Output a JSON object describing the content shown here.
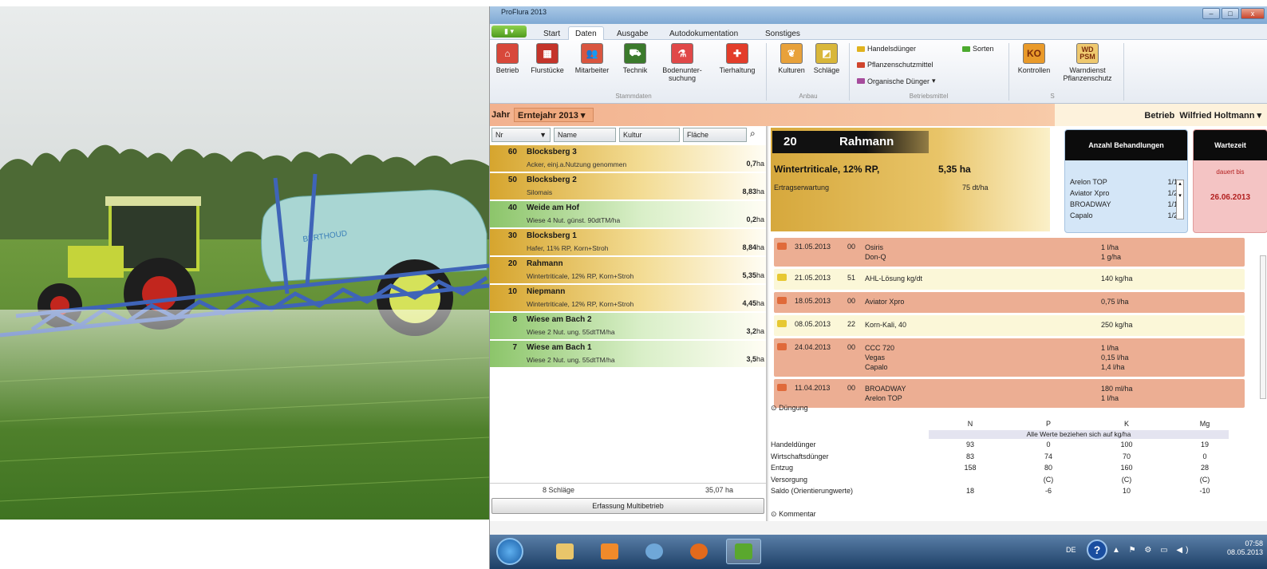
{
  "window": {
    "title": "ProFlura 2013",
    "minimize": "–",
    "maximize": "□",
    "close": "x"
  },
  "tabs": [
    {
      "label": "Start"
    },
    {
      "label": "Daten"
    },
    {
      "label": "Ausgabe"
    },
    {
      "label": "Autodokumentation"
    },
    {
      "label": "Sonstiges"
    }
  ],
  "ribbon": {
    "stammdaten": [
      {
        "label": "Betrieb",
        "color": "#d8483a"
      },
      {
        "label": "Flurstücke",
        "color": "#c4342a"
      },
      {
        "label": "Mitarbeiter",
        "color": "#d9553f"
      },
      {
        "label": "Technik",
        "color": "#3b7a2c"
      },
      {
        "label": "Bodenunter-\nsuchung",
        "color": "#e04848"
      },
      {
        "label": "Tierhaltung",
        "color": "#e33d2a"
      }
    ],
    "stammdaten_group": "Stammdaten",
    "anbau": [
      {
        "label": "Kulturen",
        "color": "#e8a13a"
      },
      {
        "label": "Schläge",
        "color": "#d9b73a"
      }
    ],
    "anbau_group": "Anbau",
    "betriebsmittel": [
      "Handelsdünger",
      "Pflanzenschutzmittel",
      "Organische Dünger"
    ],
    "sorten": "Sorten",
    "betriebsmittel_group": "Betriebsmittel",
    "kontrollen": {
      "label": "Kontrollen",
      "icon": "KO"
    },
    "warndienst": {
      "label": "Warndienst\nPflanzenschutz",
      "icon": "WD\nPSM"
    },
    "group_s": "S"
  },
  "yearbar": {
    "label": "Jahr",
    "value": "Erntejahr 2013",
    "betrieb_label": "Betrieb",
    "betrieb_value": "Wilfried Holtmann"
  },
  "list": {
    "columns": [
      "Nr",
      "Name",
      "Kultur",
      "Fläche"
    ],
    "rows": [
      {
        "nr": "60",
        "name": "Blocksberg 3",
        "sub": "Acker, einj.a.Nutzung genommen",
        "flaeche": "0,7",
        "unit": "ha",
        "color": "#d6a52e"
      },
      {
        "nr": "50",
        "name": "Blocksberg 2",
        "sub": "Silomais",
        "flaeche": "8,83",
        "unit": "ha",
        "color": "#d6a52e"
      },
      {
        "nr": "40",
        "name": "Weide am Hof",
        "sub": "Wiese 4 Nut. günst. 90dtTM/ha",
        "flaeche": "0,2",
        "unit": "ha",
        "color": "#8cc56a"
      },
      {
        "nr": "30",
        "name": "Blocksberg 1",
        "sub": "Hafer, 11% RP, Korn+Stroh",
        "flaeche": "8,84",
        "unit": "ha",
        "color": "#d6a52e"
      },
      {
        "nr": "20",
        "name": "Rahmann",
        "sub": "Wintertriticale, 12% RP, Korn+Stroh",
        "flaeche": "5,35",
        "unit": "ha",
        "color": "#d6a52e"
      },
      {
        "nr": "10",
        "name": "Niepmann",
        "sub": "Wintertriticale, 12% RP, Korn+Stroh",
        "flaeche": "4,45",
        "unit": "ha",
        "color": "#d6a52e"
      },
      {
        "nr": "8",
        "name": "Wiese am Bach 2",
        "sub": "Wiese 2 Nut. ung.  55dtTM/ha",
        "flaeche": "3,2",
        "unit": "ha",
        "color": "#8cc56a"
      },
      {
        "nr": "7",
        "name": "Wiese am Bach 1",
        "sub": "Wiese 2 Nut. ung.  55dtTM/ha",
        "flaeche": "3,5",
        "unit": "ha",
        "color": "#8cc56a"
      }
    ],
    "count": "8 Schläge",
    "total": "35,07 ha",
    "button": "Erfassung Multibetrieb"
  },
  "detail": {
    "nr": "20",
    "name": "Rahmann",
    "kultur": "Wintertriticale, 12% RP,",
    "flaeche": "5,35  ha",
    "ertrag_label": "Ertragserwartung",
    "ertrag_value": "75  dt/ha"
  },
  "behandlungen": {
    "title": "Anzahl Behandlungen",
    "items": [
      {
        "name": "Arelon TOP",
        "count": "1/1"
      },
      {
        "name": "Aviator Xpro",
        "count": "1/2"
      },
      {
        "name": "BROADWAY",
        "count": "1/1"
      },
      {
        "name": "Capalo",
        "count": "1/2"
      }
    ]
  },
  "wartezeit": {
    "title": "Wartezeit",
    "sub": "dauert bis",
    "date": "26.06.2013"
  },
  "massnahmen": [
    {
      "date": "31.05.2013",
      "code": "00",
      "products": "Osiris\nDon-Q",
      "amounts": "1 l/ha\n1 g/ha",
      "type": "psm"
    },
    {
      "date": "21.05.2013",
      "code": "51",
      "products": "AHL-Lösung kg/dt",
      "amounts": "140 kg/ha",
      "type": "dung"
    },
    {
      "date": "18.05.2013",
      "code": "00",
      "products": "Aviator Xpro",
      "amounts": "0,75 l/ha",
      "type": "psm"
    },
    {
      "date": "08.05.2013",
      "code": "22",
      "products": "Korn-Kali, 40",
      "amounts": "250 kg/ha",
      "type": "dung"
    },
    {
      "date": "24.04.2013",
      "code": "00",
      "products": "CCC 720\nVegas\nCapalo",
      "amounts": "1  l/ha\n0,15 l/ha\n1,4  l/ha",
      "type": "psm"
    },
    {
      "date": "11.04.2013",
      "code": "00",
      "products": "BROADWAY\nArelon TOP",
      "amounts": "180 ml/ha\n1  l/ha",
      "type": "psm"
    }
  ],
  "duengung": {
    "title": "Düngung",
    "columns": [
      "N",
      "P",
      "K",
      "Mg"
    ],
    "note": "Alle Werte beziehen sich auf kg/ha",
    "rows": [
      {
        "label": "Handeldünger",
        "values": [
          "93",
          "0",
          "100",
          "19"
        ]
      },
      {
        "label": "Wirtschaftsdünger",
        "values": [
          "83",
          "74",
          "70",
          "0"
        ]
      },
      {
        "label": "Entzug",
        "values": [
          "158",
          "80",
          "160",
          "28"
        ]
      },
      {
        "label": "Versorgung",
        "values": [
          "",
          "(C)",
          "(C)",
          "(C)"
        ]
      },
      {
        "label": "Saldo (Orientierungwerte)",
        "values": [
          "18",
          "-6",
          "10",
          "-10"
        ]
      }
    ],
    "kommentar": "Kommentar"
  },
  "taskbar": {
    "lang": "DE",
    "help": "?",
    "time": "07:58",
    "date": "08.05.2013",
    "tray": "▲ ⚑ ⚙ ▭ ◀)"
  },
  "colors": {
    "psm": "#ecae93",
    "dung": "#fbf7d8",
    "gold": "#d6a52e",
    "green": "#8cc56a"
  }
}
